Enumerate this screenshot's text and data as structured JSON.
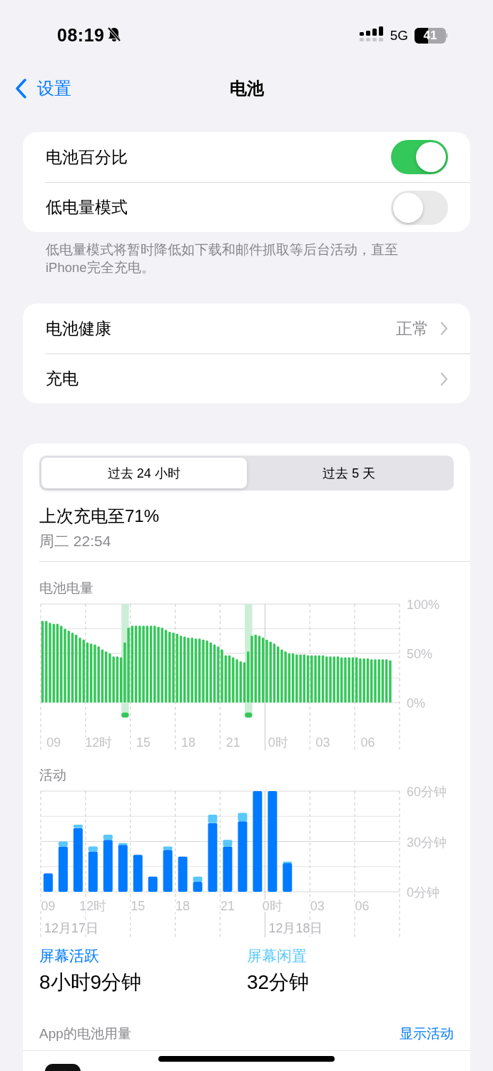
{
  "status_bar": {
    "time": "08:19",
    "network": "5G",
    "battery": "41"
  },
  "nav": {
    "back": "设置",
    "title": "电池"
  },
  "group_1": {
    "rows": [
      {
        "label": "电池百分比",
        "on": true
      },
      {
        "label": "低电量模式",
        "on": false
      }
    ],
    "footer": "低电量模式将暂时降低如下载和邮件抓取等后台活动，直至iPhone完全充电。"
  },
  "group_2": {
    "rows": [
      {
        "label": "电池健康",
        "value": "正常"
      },
      {
        "label": "充电"
      }
    ]
  },
  "usage": {
    "tabs": [
      {
        "label": "过去 24 小时",
        "selected": true
      },
      {
        "label": "过去 5 天",
        "selected": false
      }
    ],
    "last_charge": "上次充电至71%",
    "last_charge_time": "周二 22:54",
    "battery_level": {
      "title": "电池电量",
      "chart_data": {
        "type": "bar",
        "categories": [
          null,
          null,
          null,
          "09",
          null,
          null,
          null,
          null,
          null,
          null,
          null,
          null,
          null,
          null,
          null,
          "12时",
          null,
          null,
          null,
          null,
          null,
          null,
          null,
          null,
          null,
          null,
          null,
          "15",
          null,
          null,
          null,
          null,
          null,
          null,
          null,
          null,
          null,
          null,
          null,
          "18",
          null,
          null,
          null,
          null,
          null,
          null,
          null,
          null,
          null,
          null,
          null,
          "21",
          null,
          null,
          null,
          null,
          null,
          null,
          null,
          null,
          null,
          null,
          null,
          "0时",
          null,
          null,
          null,
          null,
          null,
          null,
          null,
          null,
          null,
          null,
          null,
          "03",
          null,
          null,
          null,
          null,
          null,
          null,
          null,
          null,
          null,
          null,
          null,
          "06",
          null,
          null,
          null,
          null,
          null,
          null,
          null,
          null
        ],
        "values": [
          83,
          83,
          81,
          80,
          80,
          78,
          75,
          73,
          71,
          69,
          66,
          64,
          61,
          60,
          59,
          57,
          54,
          52,
          50,
          47,
          47,
          46,
          61,
          76,
          78,
          78,
          78,
          78,
          78,
          78,
          78,
          77,
          76,
          74,
          72,
          71,
          70,
          68,
          67,
          66,
          66,
          65,
          65,
          64,
          63,
          61,
          59,
          57,
          54,
          48,
          48,
          46,
          44,
          42,
          41,
          52,
          68,
          69,
          68,
          66,
          64,
          62,
          60,
          57,
          54,
          52,
          50,
          50,
          49,
          49,
          49,
          48,
          48,
          48,
          48,
          48,
          47,
          47,
          47,
          47,
          46,
          46,
          46,
          46,
          46,
          45,
          45,
          45,
          44,
          44,
          44,
          44,
          44,
          43,
          null,
          null
        ],
        "ylim": [
          0,
          100
        ],
        "yticks": [
          {
            "value": 0,
            "label": "0%"
          },
          {
            "value": 50,
            "label": "50%"
          },
          {
            "value": 100,
            "label": "100%"
          }
        ]
      }
    },
    "activity": {
      "title": "活动",
      "chart_data": {
        "type": "bar",
        "stacked": true,
        "ylim": [
          0,
          60
        ],
        "categories": [
          "09",
          null,
          null,
          "12时",
          null,
          null,
          "15",
          null,
          null,
          "18",
          null,
          null,
          "21",
          null,
          null,
          "0时",
          null,
          null,
          "03",
          null,
          null,
          "06",
          null,
          null
        ],
        "series": [
          {
            "name": "屏幕活跃",
            "color": "#007aff",
            "values": [
              11,
              27,
              38,
              24,
              31,
              28,
              22,
              9,
              25,
              21,
              6,
              41,
              27,
              42,
              60,
              60,
              17,
              null,
              null,
              null,
              null,
              null,
              null,
              null
            ]
          },
          {
            "name": "屏幕闲置",
            "color": "#5ac8fa",
            "values": [
              0,
              3,
              2,
              3,
              3,
              1,
              0,
              0,
              2,
              0,
              3,
              5,
              4,
              5,
              0,
              0,
              1,
              null,
              null,
              null,
              null,
              null,
              null,
              null
            ]
          }
        ],
        "yticks": [
          {
            "value": 0,
            "label": "0分钟"
          },
          {
            "value": 30,
            "label": "30分钟"
          },
          {
            "value": 60,
            "label": "60分钟"
          }
        ],
        "annotations": [
          "12月17日",
          "12月18日"
        ]
      }
    },
    "summary": [
      {
        "value": "8小时9分钟"
      },
      {
        "value": "32分钟"
      }
    ],
    "app_usage_title": "App的电池用量",
    "show_activity": "显示活动"
  }
}
